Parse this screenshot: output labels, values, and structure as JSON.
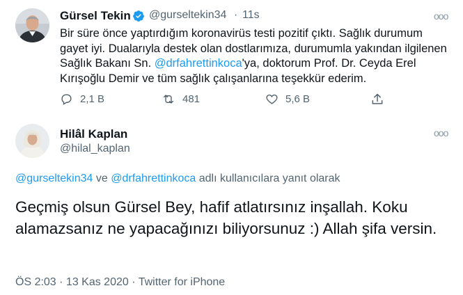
{
  "tweet1": {
    "author_name": "Gürsel Tekin",
    "handle": "@gurseltekin34",
    "separator": "·",
    "time": "11s",
    "text_part1": "Bir süre önce yaptırdığım koronavirüs testi pozitif çıktı. Sağlık durumum gayet iyi. Dualarıyla destek olan dostlarımıza, durumumla yakından ilgilenen Sağlık Bakanı Sn. ",
    "mention": "@drfahrettinkoca",
    "text_part2": "'ya, doktorum Prof. Dr. Ceyda Erel Kırışoğlu Demir ve tüm sağlık çalışanlarına teşekkür ederim.",
    "replies": "2,1 B",
    "retweets": "481",
    "likes": "5,6 B",
    "more_label": "ooo"
  },
  "tweet2": {
    "author_name": "Hilâl Kaplan",
    "handle": "@hilal_kaplan",
    "more_label": "ooo",
    "reply_mention1": "@gurseltekin34",
    "reply_and": " ve ",
    "reply_mention2": "@drfahrettinkoca",
    "reply_suffix": " adlı kullanıcılara yanıt olarak",
    "text": "Geçmiş olsun Gürsel Bey, hafif atlatırsınız inşallah. Koku alamazsanız ne yapacağınızı biliyorsunuz :) Allah şifa versin.",
    "timestamp": "ÖS 2:03 · 13 Kas 2020 · Twitter for iPhone"
  },
  "colors": {
    "link": "#1d9bf0",
    "verified": "#1d9bf0",
    "secondary": "#536471"
  }
}
